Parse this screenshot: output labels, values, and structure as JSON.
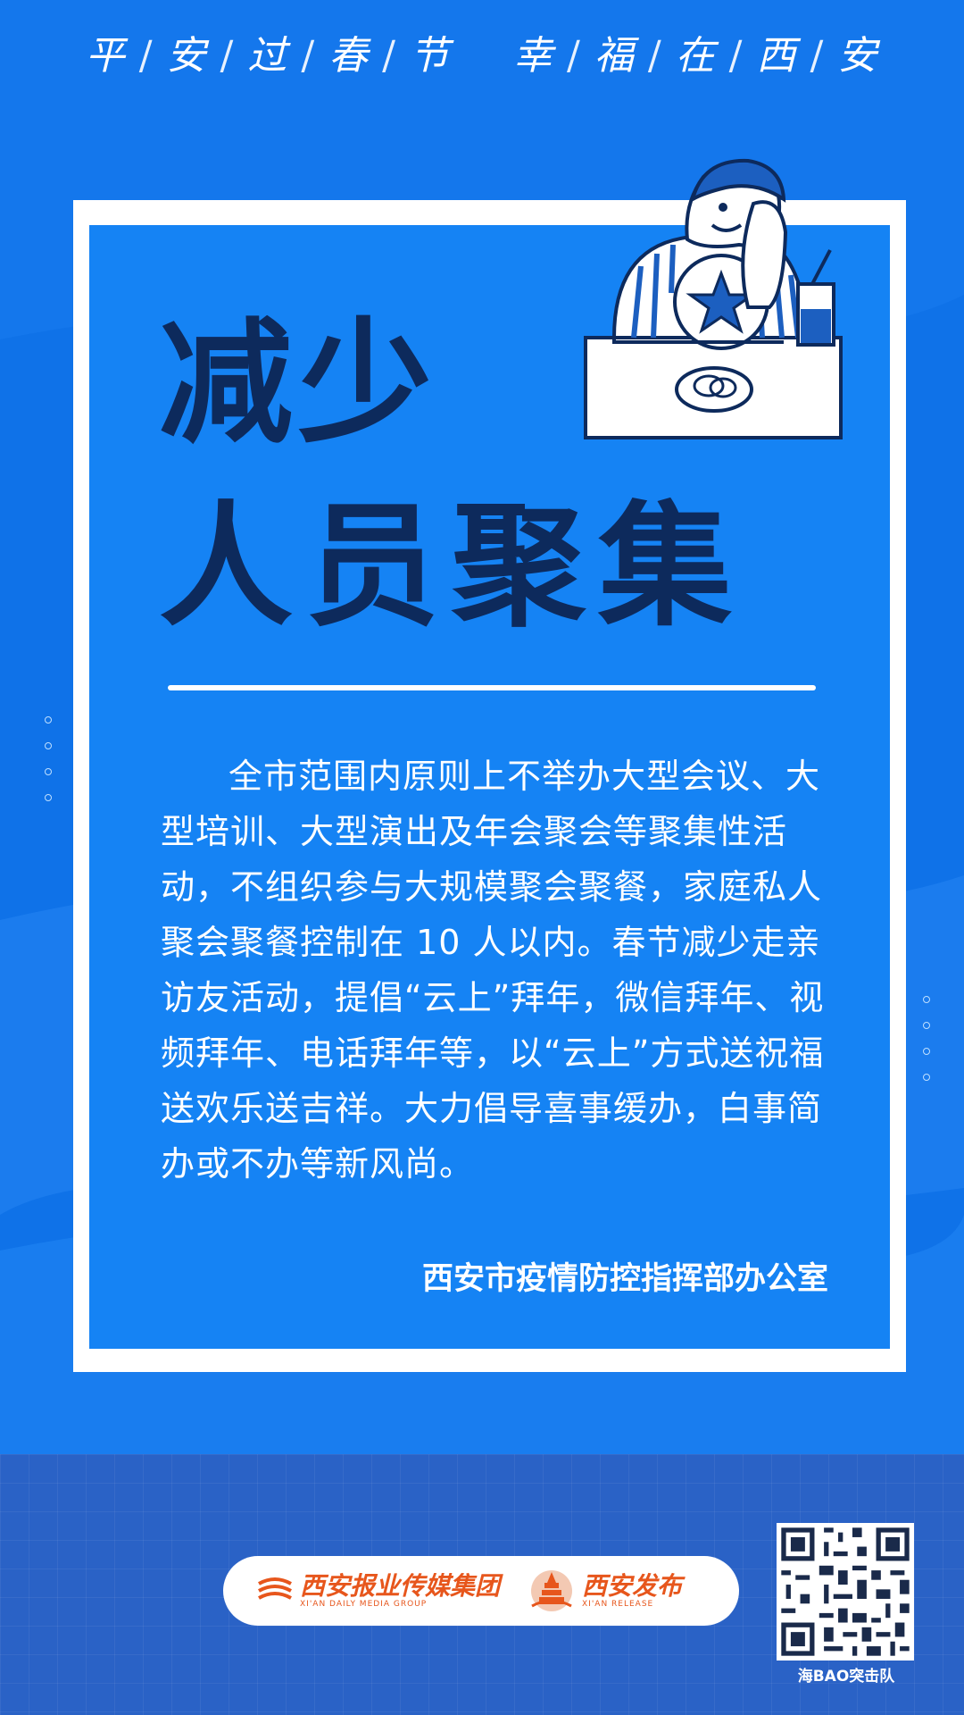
{
  "slogan": {
    "part1": [
      "平",
      "安",
      "过",
      "春",
      "节"
    ],
    "part2": [
      "幸",
      "福",
      "在",
      "西",
      "安"
    ]
  },
  "headline": {
    "line1": "减少",
    "line2": "人员聚集"
  },
  "body_paragraph": "全市范围内原则上不举办大型会议、大型培训、大型演出及年会聚会等聚集性活动，不组织参与大规模聚会聚餐，家庭私人聚会聚餐控制在 10 人以内。春节减少走亲访友活动，提倡“云上”拜年，微信拜年、视频拜年、电话拜年等，以“云上”方式送祝福送欢乐送吉祥。大力倡导喜事缓办，白事简办或不办等新风尚。",
  "issuer": "西安市疫情防控指挥部办公室",
  "footer": {
    "logo1_title": "西安报业传媒集团",
    "logo1_sub": "XI'AN DAILY MEDIA GROUP",
    "logo2_title": "西安发布",
    "logo2_sub": "XI'AN RELEASE",
    "qr_caption": "海BAO突击队"
  },
  "colors": {
    "background": "#0f72e8",
    "card_blue": "#1583f4",
    "headline_navy": "#0d2a5c",
    "logo_orange": "#e7561c"
  }
}
